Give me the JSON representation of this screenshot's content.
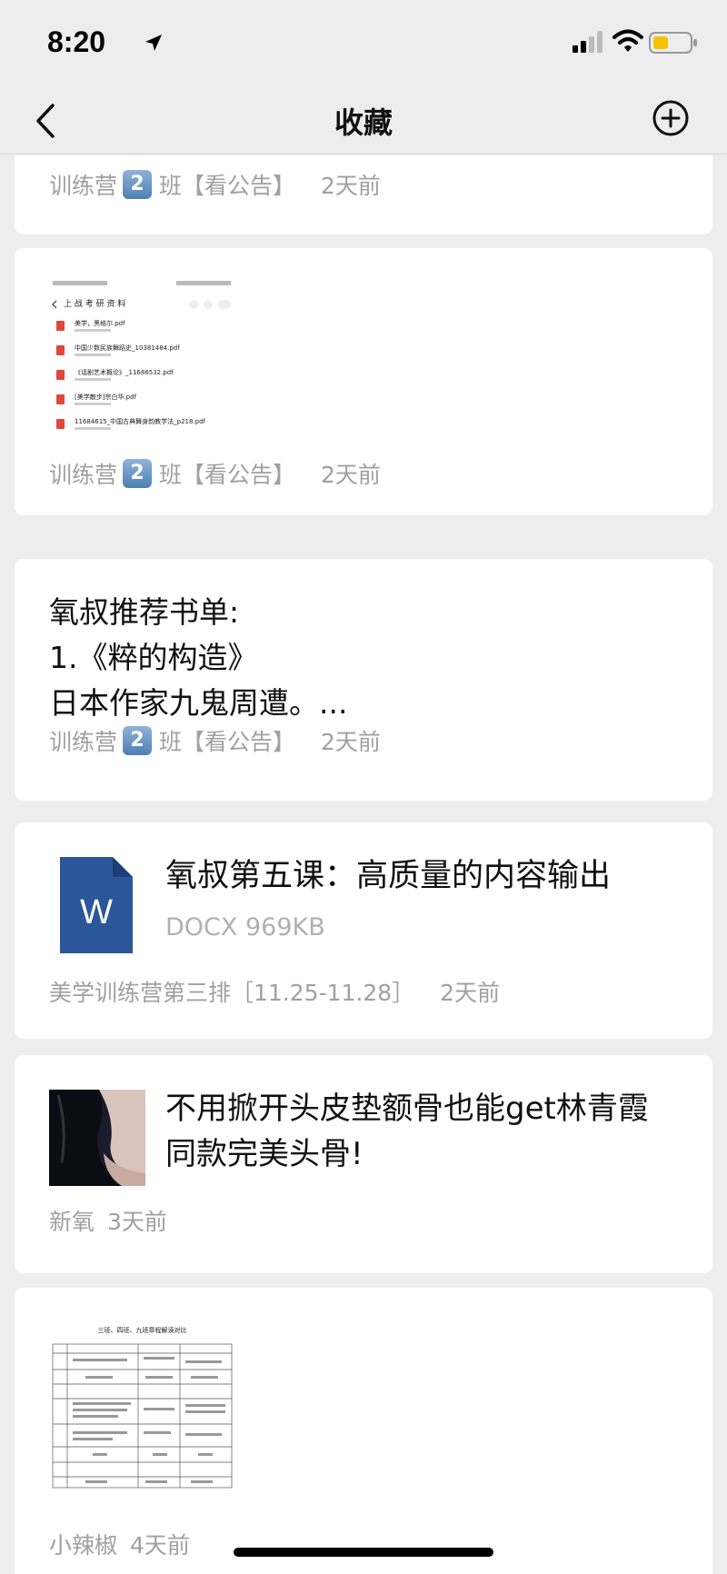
{
  "status": {
    "time": "8:20"
  },
  "nav": {
    "title": "收藏"
  },
  "items": [
    {
      "type": "partial",
      "source": "训练营",
      "badge": "2",
      "source_suffix": "班【看公告】",
      "time": "2天前"
    },
    {
      "type": "image",
      "source": "训练营",
      "badge": "2",
      "source_suffix": "班【看公告】",
      "time": "2天前",
      "thumb": {
        "header": "上 战 考 研 资 料",
        "files": [
          {
            "name": "美学，黑格尔.pdf"
          },
          {
            "name": "中国少数民族舞蹈史_10381484.pdf"
          },
          {
            "name": "《话剧艺术概论》_11686532.pdf"
          },
          {
            "name": "[美学散步]宗白华.pdf"
          },
          {
            "name": "11684615_中国古典舞身韵教学法_p218.pdf"
          }
        ]
      }
    },
    {
      "type": "note",
      "text": "氧叔推荐书单:\n1.《粹的构造》\n日本作家九鬼周遭。...",
      "source": "训练营",
      "badge": "2",
      "source_suffix": "班【看公告】",
      "time": "2天前"
    },
    {
      "type": "file",
      "icon_letter": "W",
      "title": "氧叔第五课：高质量的内容输出",
      "size": "DOCX 969KB",
      "source": "美学训练营第三排［11.25-11.28］",
      "time": "2天前"
    },
    {
      "type": "article",
      "title": "不用掀开头皮垫额骨也能get林青霞同款完美头骨!",
      "source": "新氧",
      "time": "3天前"
    },
    {
      "type": "image",
      "source": "小辣椒",
      "time": "4天前",
      "thumb": {
        "header": "三班、四班、九班章程解读对比"
      }
    }
  ],
  "colors": {
    "background": "#ededed",
    "card": "#ffffff",
    "meta": "#a0a0a0",
    "word_blue": "#2b579a",
    "badge": "#4f7fb3"
  }
}
